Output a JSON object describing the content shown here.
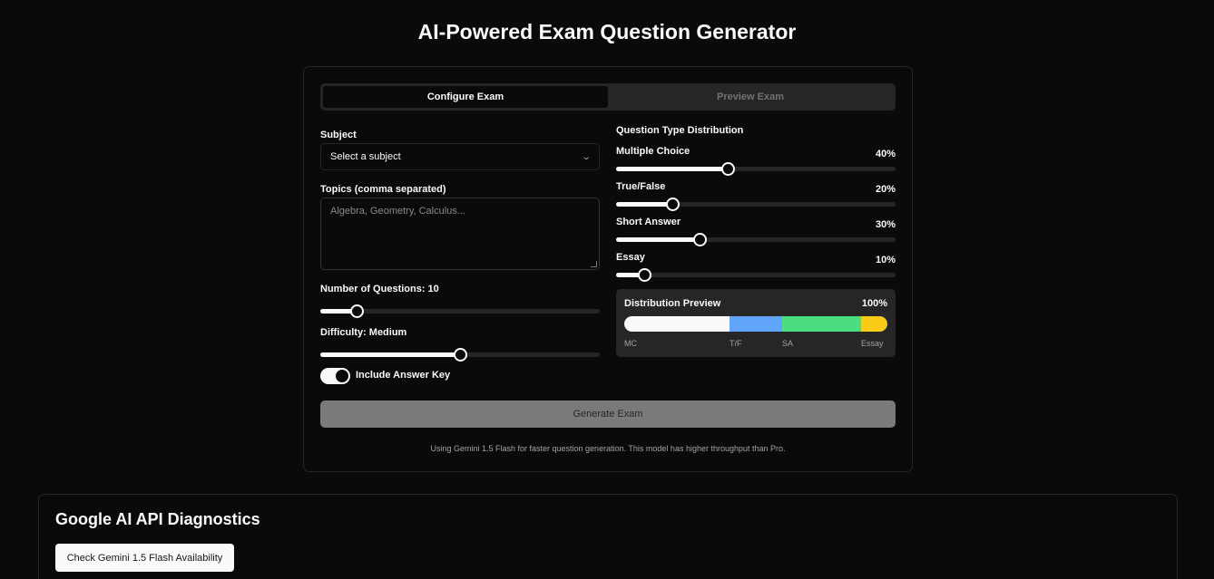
{
  "page_title": "AI-Powered Exam Question Generator",
  "tabs": [
    {
      "label": "Configure Exam",
      "active": true
    },
    {
      "label": "Preview Exam",
      "active": false
    }
  ],
  "subject": {
    "label": "Subject",
    "value": "Select a subject"
  },
  "topics": {
    "label": "Topics (comma separated)",
    "placeholder": "Algebra, Geometry, Calculus..."
  },
  "num_questions": {
    "label": "Number of Questions: 10",
    "value": 10,
    "level": 0.13
  },
  "difficulty": {
    "label": "Difficulty: Medium",
    "value": "Medium",
    "level": 0.5
  },
  "answer_key": {
    "label": "Include Answer Key",
    "checked": true
  },
  "distribution": {
    "title": "Question Type Distribution",
    "types": [
      {
        "label": "Multiple Choice",
        "percent": 40,
        "percent_text": "40%"
      },
      {
        "label": "True/False",
        "percent": 20,
        "percent_text": "20%"
      },
      {
        "label": "Short Answer",
        "percent": 30,
        "percent_text": "30%"
      },
      {
        "label": "Essay",
        "percent": 10,
        "percent_text": "10%"
      }
    ]
  },
  "preview": {
    "title": "Distribution Preview",
    "total": "100%",
    "segments": [
      {
        "label": "MC",
        "percent": 40,
        "color": "#fafafa"
      },
      {
        "label": "T/F",
        "percent": 20,
        "color": "#60a5fa"
      },
      {
        "label": "SA",
        "percent": 30,
        "color": "#4ade80"
      },
      {
        "label": "Essay",
        "percent": 10,
        "color": "#facc15"
      }
    ]
  },
  "generate_button": "Generate Exam",
  "model_note": "Using Gemini 1.5 Flash for faster question generation. This model has higher throughput than Pro.",
  "diagnostics": {
    "title": "Google AI API Diagnostics",
    "button": "Check Gemini 1.5 Flash Availability"
  }
}
